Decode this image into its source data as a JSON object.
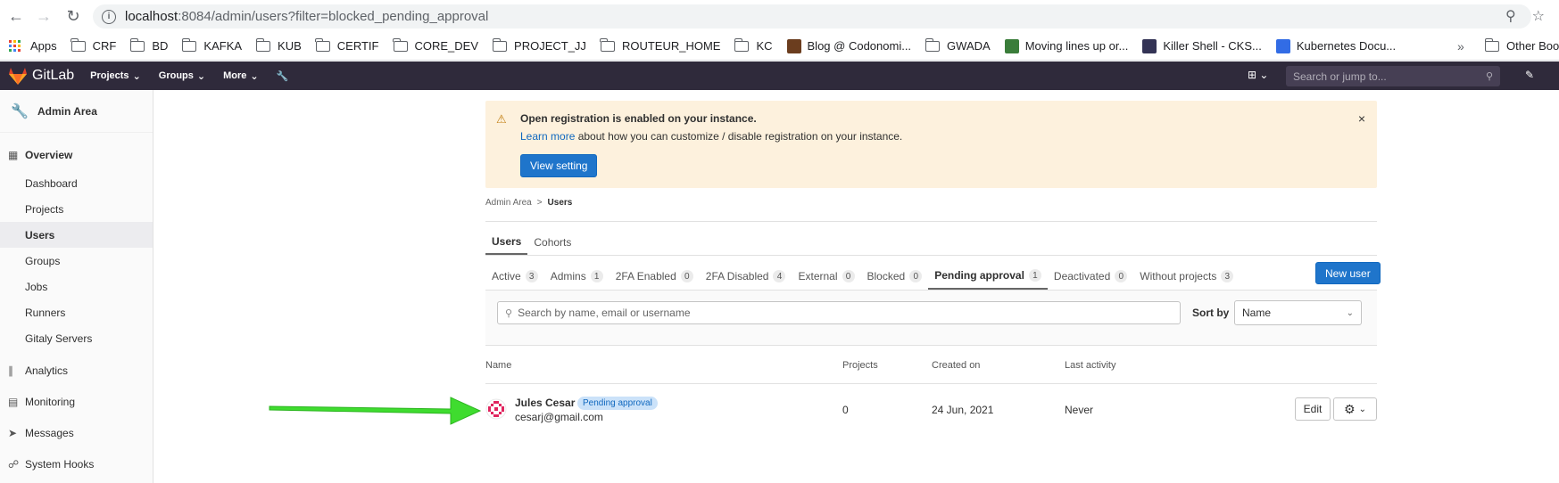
{
  "browser": {
    "url_host": "localhost",
    "url_rest": ":8084/admin/users?filter=blocked_pending_approval"
  },
  "bookmarks": [
    {
      "label": "Apps",
      "icon": "apps-grid-icon"
    },
    {
      "label": "CRF",
      "icon": "folder-icon"
    },
    {
      "label": "BD",
      "icon": "folder-icon"
    },
    {
      "label": "KAFKA",
      "icon": "folder-icon"
    },
    {
      "label": "KUB",
      "icon": "folder-icon"
    },
    {
      "label": "CERTIF",
      "icon": "folder-icon"
    },
    {
      "label": "CORE_DEV",
      "icon": "folder-icon"
    },
    {
      "label": "PROJECT_JJ",
      "icon": "folder-icon"
    },
    {
      "label": "ROUTEUR_HOME",
      "icon": "folder-icon"
    },
    {
      "label": "KC",
      "icon": "folder-icon"
    },
    {
      "label": "Blog @ Codonomi...",
      "icon": "favicon"
    },
    {
      "label": "GWADA",
      "icon": "folder-icon"
    },
    {
      "label": "Moving lines up or...",
      "icon": "favicon"
    },
    {
      "label": "Killer Shell - CKS...",
      "icon": "favicon"
    },
    {
      "label": "Kubernetes Docu...",
      "icon": "favicon"
    }
  ],
  "bookmarks_more": "»",
  "other_bookmarks": "Other Book",
  "topnav": {
    "brand": "GitLab",
    "menu": [
      "Projects",
      "Groups",
      "More"
    ],
    "search_placeholder": "Search or jump to..."
  },
  "sidebar": {
    "header": "Admin Area",
    "overview": "Overview",
    "overview_items": [
      "Dashboard",
      "Projects",
      "Users",
      "Groups",
      "Jobs",
      "Runners",
      "Gitaly Servers"
    ],
    "active_item": "Users",
    "top_items": [
      "Analytics",
      "Monitoring",
      "Messages",
      "System Hooks"
    ]
  },
  "alert": {
    "title": "Open registration is enabled on your instance.",
    "link": "Learn more",
    "body": " about how you can customize / disable registration on your instance.",
    "button": "View setting",
    "close": "×"
  },
  "breadcrumb": {
    "parent": "Admin Area",
    "sep": ">",
    "current": "Users"
  },
  "tabs": [
    "Users",
    "Cohorts"
  ],
  "filter_tabs": [
    {
      "label": "Active",
      "count": "3"
    },
    {
      "label": "Admins",
      "count": "1"
    },
    {
      "label": "2FA Enabled",
      "count": "0"
    },
    {
      "label": "2FA Disabled",
      "count": "4"
    },
    {
      "label": "External",
      "count": "0"
    },
    {
      "label": "Blocked",
      "count": "0"
    },
    {
      "label": "Pending approval",
      "count": "1"
    },
    {
      "label": "Deactivated",
      "count": "0"
    },
    {
      "label": "Without projects",
      "count": "3"
    }
  ],
  "new_user_button": "New user",
  "search": {
    "placeholder": "Search by name, email or username",
    "sort_label": "Sort by",
    "sort_value": "Name"
  },
  "table": {
    "headers": [
      "Name",
      "Projects",
      "Created on",
      "Last activity"
    ],
    "row": {
      "name": "Jules Cesar",
      "badge": "Pending approval",
      "email": "cesarj@gmail.com",
      "projects": "0",
      "created": "24 Jun, 2021",
      "last_activity": "Never",
      "edit": "Edit"
    }
  },
  "colors": {
    "nav_bg": "#2f2a3b",
    "primary": "#1f75cb",
    "alert_bg": "#fdf1dd",
    "arrow": "#3fdc2f"
  }
}
